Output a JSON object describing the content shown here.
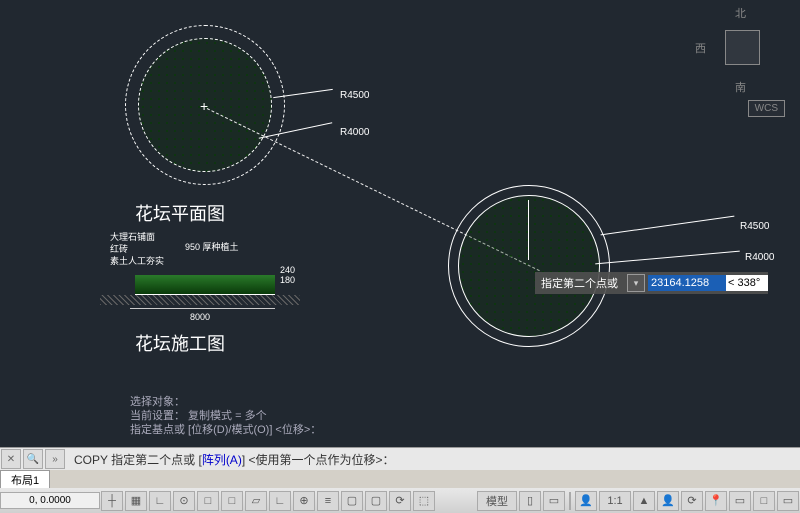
{
  "viewcube": {
    "n": "北",
    "w": "西",
    "s": "南",
    "wcs": "WCS"
  },
  "drawing": {
    "title_plan": "花坛平面图",
    "title_section": "花坛施工图",
    "dim_r4500": "R4500",
    "dim_r4000": "R4000",
    "dim_r4500b": "R4500",
    "dim_r4000b": "R4000",
    "cross": "+",
    "sect_label1": "大理石铺面",
    "sect_label2": "红砖",
    "sect_label3": "素土人工夯实",
    "sect_label4": "950 厚种植土",
    "sect_d1": "240",
    "sect_d2": "180",
    "sect_d3": "8000"
  },
  "prompt": {
    "label": "指定第二个点或",
    "value": "23164.1258",
    "angle": "< 338°"
  },
  "history": {
    "l1": "选择对象：",
    "l2": "当前设置：  复制模式 = 多个",
    "l3": "指定基点或 [位移(D)/模式(O)] <位移>："
  },
  "command": {
    "cmd": "COPY",
    "text": "指定第二个点或 [",
    "opt": "阵列(A)",
    "text2": "] <使用第一个点作为位移>："
  },
  "tabs": {
    "layout1": "布局1"
  },
  "statusbar": {
    "coord": "0, 0.0000",
    "model": "模型",
    "scale": "1:1"
  },
  "icons": {
    "x": "✕",
    "search": "🔍",
    "cmd": "»",
    "grid": "▦",
    "snap": "┼",
    "ortho": "∟",
    "polar": "⊙",
    "osnap": "□",
    "otrack": "▱",
    "dyn": "⊕",
    "lwt": "≡",
    "qp": "▢",
    "ws": "⟳",
    "ann": "⬚",
    "ms": "▯",
    "model": "▭",
    "person": "👤",
    "tri": "▲",
    "pin": "📍"
  }
}
